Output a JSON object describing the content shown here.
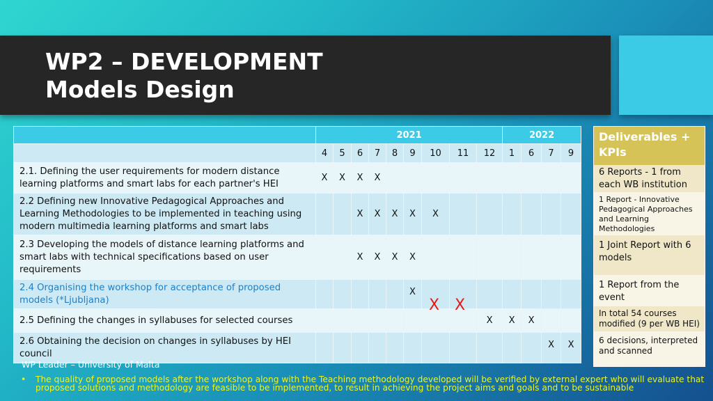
{
  "slide": {
    "title_line1": "WP2 – DEVELOPMENT",
    "title_line2": "Models Design"
  },
  "schedule": {
    "years": [
      {
        "label": "2021",
        "span": 9
      },
      {
        "label": "2022",
        "span": 4
      }
    ],
    "months": [
      "4",
      "5",
      "6",
      "7",
      "8",
      "9",
      "10",
      "11",
      "12",
      "1",
      "6",
      "7",
      "9"
    ],
    "tasks": [
      {
        "label": "2.1. Defining the user requirements for modern distance learning platforms and smart labs for each partner's HEI",
        "marks": [
          "X",
          "X",
          "X",
          "X",
          "",
          "",
          "",
          "",
          "",
          "",
          "",
          "",
          ""
        ],
        "highlight": false
      },
      {
        "label": "2.2 Defining new Innovative Pedagogical Approaches and Learning Methodologies to be implemented in teaching using modern multimedia learning platforms and smart labs",
        "marks": [
          "",
          "",
          "X",
          "X",
          "X",
          "X",
          "X",
          "",
          "",
          "",
          "",
          "",
          ""
        ],
        "highlight": false
      },
      {
        "label": "2.3 Developing the models of distance learning platforms and smart labs with technical specifications based on user requirements",
        "marks": [
          "",
          "",
          "X",
          "X",
          "X",
          "X",
          "",
          "",
          "",
          "",
          "",
          "",
          ""
        ],
        "highlight": false
      },
      {
        "label": "2.4 Organising the workshop for acceptance of proposed models (*Ljubljana)",
        "marks": [
          "",
          "",
          "",
          "",
          "",
          "X",
          "",
          "",
          "",
          "",
          "",
          "",
          ""
        ],
        "highlight": true
      },
      {
        "label": "2.5 Defining the changes in syllabuses for selected courses",
        "marks": [
          "",
          "",
          "",
          "",
          "",
          "",
          "",
          "",
          "X",
          "X",
          "X",
          "",
          ""
        ],
        "highlight": false
      },
      {
        "label": "2.6 Obtaining the decision on changes in syllabuses by HEI council",
        "marks": [
          "",
          "",
          "",
          "",
          "",
          "",
          "",
          "",
          "",
          "",
          "",
          "X",
          "X"
        ],
        "highlight": false
      }
    ],
    "red_marks": {
      "label": "X",
      "months": [
        "10",
        "11"
      ],
      "color": "#e81818"
    }
  },
  "deliverables": {
    "heading": "Deliverables + KPIs",
    "items": [
      "6 Reports - 1 from each WB institution",
      "1 Report - Innovative Pedagogical Approaches and Learning Methodologies",
      "1 Joint Report with 6 models",
      "1 Report from the event",
      "In total 54 courses modified (9 per WB HEI)",
      "6 decisions, interpreted and scanned"
    ]
  },
  "footer": {
    "leader": "WP Leader – University of Malta",
    "bullet": "•",
    "note": "The quality of proposed models after the workshop along with the Teaching methodology developed will be verified by external expert who will evaluate that proposed solutions and methodology are feasible to be implemented, to result in achieving the project aims and goals and to be sustainable"
  },
  "colors": {
    "title_bar": "#262626",
    "accent": "#3ccbe6",
    "deliverables_header": "#d6c358",
    "note_text": "#e7f52a",
    "highlight_task": "#1f7fc4"
  }
}
